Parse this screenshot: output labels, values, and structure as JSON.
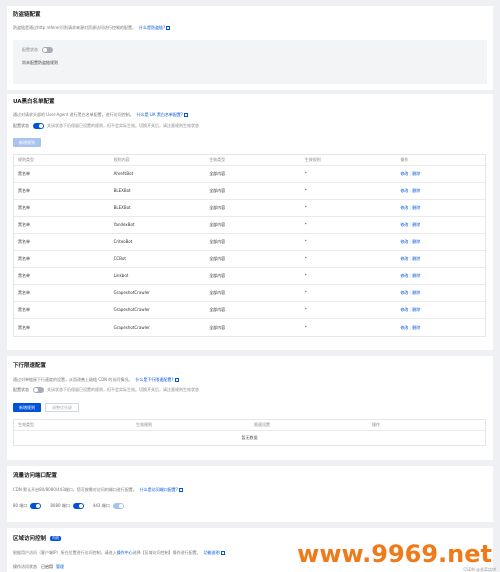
{
  "section1": {
    "title": "防盗链配置",
    "desc": "防盗链是通过http referer识别请求来源对资源访问进行控制的配置。",
    "link": "什么是防盗链?",
    "status_label": "配置状态",
    "status_text": "尚未配置防盗链规则"
  },
  "section2": {
    "title": "UA黑白名单配置",
    "desc": "通过对请求头部的 User-Agent 进行黑白名单配置，进行访问控制。",
    "link": "什么是 UA 黑白名单配置?",
    "status_label": "配置状态",
    "status_note": "关闭状态下仍保留已设置的规则，但不会实际生效。切换开关后，请注意规则生效状态",
    "add_button": "新增规则",
    "columns": [
      "规则类型",
      "规则内容",
      "生效类型",
      "生效规则",
      "操作"
    ],
    "rows": [
      {
        "type": "黑名单",
        "content": "AhrefsBot",
        "scope": "全部内容",
        "rule": "*"
      },
      {
        "type": "黑名单",
        "content": "BLEXBot",
        "scope": "全部内容",
        "rule": "*"
      },
      {
        "type": "黑名单",
        "content": "BLEXBot",
        "scope": "全部内容",
        "rule": "*"
      },
      {
        "type": "黑名单",
        "content": "YandexBot",
        "scope": "全部内容",
        "rule": "*"
      },
      {
        "type": "黑名单",
        "content": "CriteoBot",
        "scope": "全部内容",
        "rule": "*"
      },
      {
        "type": "黑名单",
        "content": "CCBot",
        "scope": "全部内容",
        "rule": "*"
      },
      {
        "type": "黑名单",
        "content": "Linkbot",
        "scope": "全部内容",
        "rule": "*"
      },
      {
        "type": "黑名单",
        "content": "GrapeshotCrawler",
        "scope": "全部内容",
        "rule": "*"
      },
      {
        "type": "黑名单",
        "content": "GrapeshotCrawler",
        "scope": "全部内容",
        "rule": "*"
      },
      {
        "type": "黑名单",
        "content": "GrapeshotCrawler",
        "scope": "全部内容",
        "rule": "*"
      }
    ],
    "edit_label": "修改",
    "delete_label": "删除"
  },
  "section3": {
    "title": "下行限速配置",
    "desc": "通过对单链接下行速度的设置，从而改善上级链 CDN 的访问情况。",
    "link": "什么是下行限速配置?",
    "status_label": "配置状态",
    "status_note": "关闭状态下仍保留已设置的规则，但不会实际生效。切换开关后，请注意规则生效状态",
    "add_button": "新增规则",
    "second_button": "调整优先级",
    "columns": [
      "生效类型",
      "生效规则",
      "限速设置",
      "操作"
    ],
    "empty": "暂无数据"
  },
  "section4": {
    "title": "流量访问端口配置",
    "desc": "CDN 默认开启80/8080/443端口，您可按需对访问的端口进行配置。",
    "link": "什么是访问端口配置?",
    "ports": [
      {
        "label": "80 端口",
        "on": true
      },
      {
        "label": "8080 端口",
        "on": true
      },
      {
        "label": "443 端口",
        "on": true
      }
    ]
  },
  "section5": {
    "title": "区域访问控制",
    "badge": "内测",
    "desc": "根据用户访问（客户端IP）所在位置进行访问控制，请进入",
    "desc_link": "操作中心",
    "desc_tail": "选择【区域访问控制】操作进行配置。",
    "link": "功能说明",
    "status_label": "操作访问状态",
    "status_value": "已启用",
    "manage": "管理"
  },
  "watermark": "www.9969.net",
  "watermark2": "CSDN @香菜烧饼"
}
